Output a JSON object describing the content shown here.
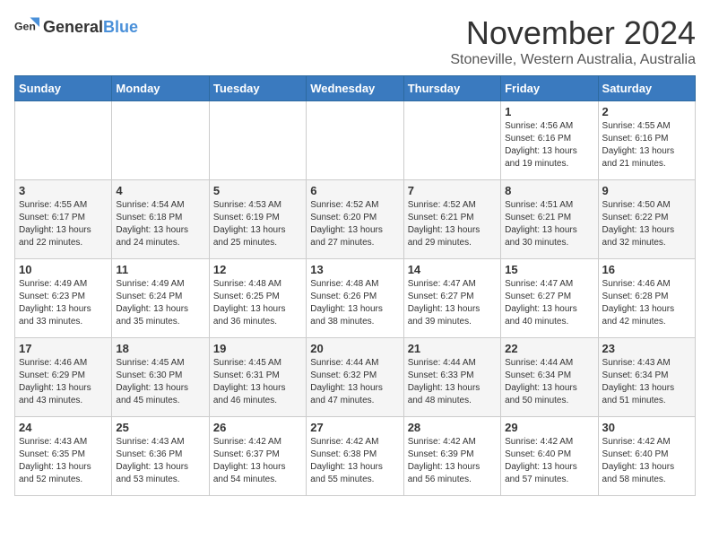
{
  "header": {
    "logo_general": "General",
    "logo_blue": "Blue",
    "month_title": "November 2024",
    "subtitle": "Stoneville, Western Australia, Australia"
  },
  "days_of_week": [
    "Sunday",
    "Monday",
    "Tuesday",
    "Wednesday",
    "Thursday",
    "Friday",
    "Saturday"
  ],
  "weeks": [
    [
      {
        "day": "",
        "info": ""
      },
      {
        "day": "",
        "info": ""
      },
      {
        "day": "",
        "info": ""
      },
      {
        "day": "",
        "info": ""
      },
      {
        "day": "",
        "info": ""
      },
      {
        "day": "1",
        "info": "Sunrise: 4:56 AM\nSunset: 6:16 PM\nDaylight: 13 hours and 19 minutes."
      },
      {
        "day": "2",
        "info": "Sunrise: 4:55 AM\nSunset: 6:16 PM\nDaylight: 13 hours and 21 minutes."
      }
    ],
    [
      {
        "day": "3",
        "info": "Sunrise: 4:55 AM\nSunset: 6:17 PM\nDaylight: 13 hours and 22 minutes."
      },
      {
        "day": "4",
        "info": "Sunrise: 4:54 AM\nSunset: 6:18 PM\nDaylight: 13 hours and 24 minutes."
      },
      {
        "day": "5",
        "info": "Sunrise: 4:53 AM\nSunset: 6:19 PM\nDaylight: 13 hours and 25 minutes."
      },
      {
        "day": "6",
        "info": "Sunrise: 4:52 AM\nSunset: 6:20 PM\nDaylight: 13 hours and 27 minutes."
      },
      {
        "day": "7",
        "info": "Sunrise: 4:52 AM\nSunset: 6:21 PM\nDaylight: 13 hours and 29 minutes."
      },
      {
        "day": "8",
        "info": "Sunrise: 4:51 AM\nSunset: 6:21 PM\nDaylight: 13 hours and 30 minutes."
      },
      {
        "day": "9",
        "info": "Sunrise: 4:50 AM\nSunset: 6:22 PM\nDaylight: 13 hours and 32 minutes."
      }
    ],
    [
      {
        "day": "10",
        "info": "Sunrise: 4:49 AM\nSunset: 6:23 PM\nDaylight: 13 hours and 33 minutes."
      },
      {
        "day": "11",
        "info": "Sunrise: 4:49 AM\nSunset: 6:24 PM\nDaylight: 13 hours and 35 minutes."
      },
      {
        "day": "12",
        "info": "Sunrise: 4:48 AM\nSunset: 6:25 PM\nDaylight: 13 hours and 36 minutes."
      },
      {
        "day": "13",
        "info": "Sunrise: 4:48 AM\nSunset: 6:26 PM\nDaylight: 13 hours and 38 minutes."
      },
      {
        "day": "14",
        "info": "Sunrise: 4:47 AM\nSunset: 6:27 PM\nDaylight: 13 hours and 39 minutes."
      },
      {
        "day": "15",
        "info": "Sunrise: 4:47 AM\nSunset: 6:27 PM\nDaylight: 13 hours and 40 minutes."
      },
      {
        "day": "16",
        "info": "Sunrise: 4:46 AM\nSunset: 6:28 PM\nDaylight: 13 hours and 42 minutes."
      }
    ],
    [
      {
        "day": "17",
        "info": "Sunrise: 4:46 AM\nSunset: 6:29 PM\nDaylight: 13 hours and 43 minutes."
      },
      {
        "day": "18",
        "info": "Sunrise: 4:45 AM\nSunset: 6:30 PM\nDaylight: 13 hours and 45 minutes."
      },
      {
        "day": "19",
        "info": "Sunrise: 4:45 AM\nSunset: 6:31 PM\nDaylight: 13 hours and 46 minutes."
      },
      {
        "day": "20",
        "info": "Sunrise: 4:44 AM\nSunset: 6:32 PM\nDaylight: 13 hours and 47 minutes."
      },
      {
        "day": "21",
        "info": "Sunrise: 4:44 AM\nSunset: 6:33 PM\nDaylight: 13 hours and 48 minutes."
      },
      {
        "day": "22",
        "info": "Sunrise: 4:44 AM\nSunset: 6:34 PM\nDaylight: 13 hours and 50 minutes."
      },
      {
        "day": "23",
        "info": "Sunrise: 4:43 AM\nSunset: 6:34 PM\nDaylight: 13 hours and 51 minutes."
      }
    ],
    [
      {
        "day": "24",
        "info": "Sunrise: 4:43 AM\nSunset: 6:35 PM\nDaylight: 13 hours and 52 minutes."
      },
      {
        "day": "25",
        "info": "Sunrise: 4:43 AM\nSunset: 6:36 PM\nDaylight: 13 hours and 53 minutes."
      },
      {
        "day": "26",
        "info": "Sunrise: 4:42 AM\nSunset: 6:37 PM\nDaylight: 13 hours and 54 minutes."
      },
      {
        "day": "27",
        "info": "Sunrise: 4:42 AM\nSunset: 6:38 PM\nDaylight: 13 hours and 55 minutes."
      },
      {
        "day": "28",
        "info": "Sunrise: 4:42 AM\nSunset: 6:39 PM\nDaylight: 13 hours and 56 minutes."
      },
      {
        "day": "29",
        "info": "Sunrise: 4:42 AM\nSunset: 6:40 PM\nDaylight: 13 hours and 57 minutes."
      },
      {
        "day": "30",
        "info": "Sunrise: 4:42 AM\nSunset: 6:40 PM\nDaylight: 13 hours and 58 minutes."
      }
    ]
  ]
}
